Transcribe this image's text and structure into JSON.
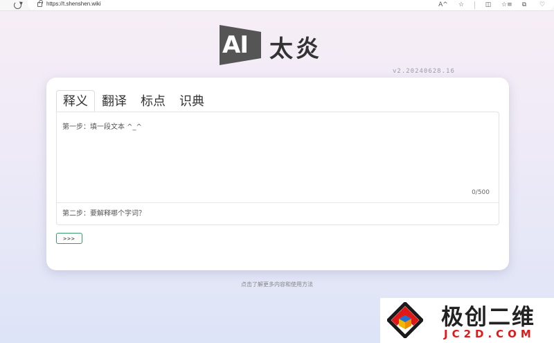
{
  "browser": {
    "url": "https://t.shenshen.wiki",
    "toolbar_icons": [
      "A^",
      "☆",
      "◫",
      "☆≡",
      "⧉",
      "♡"
    ]
  },
  "logo": {
    "mark_text": "AI",
    "name": "太炎"
  },
  "version": "v2.20240628.16",
  "tabs": [
    {
      "label": "释义",
      "active": true
    },
    {
      "label": "翻译",
      "active": false
    },
    {
      "label": "标点",
      "active": false
    },
    {
      "label": "识典",
      "active": false
    }
  ],
  "form": {
    "text_placeholder": "第一步：填一段文本 ^_^",
    "counter": "0/500",
    "word_placeholder": "第二步：要解释哪个字词？",
    "submit_label": ">>>"
  },
  "help_link": "点击了解更多内容和使用方法",
  "watermark": {
    "cn": "极创二维",
    "en": "JC2D.COM"
  },
  "colors": {
    "accent_green": "#3a9a6a",
    "watermark_red": "#e01818",
    "logo_dark": "#555555"
  }
}
